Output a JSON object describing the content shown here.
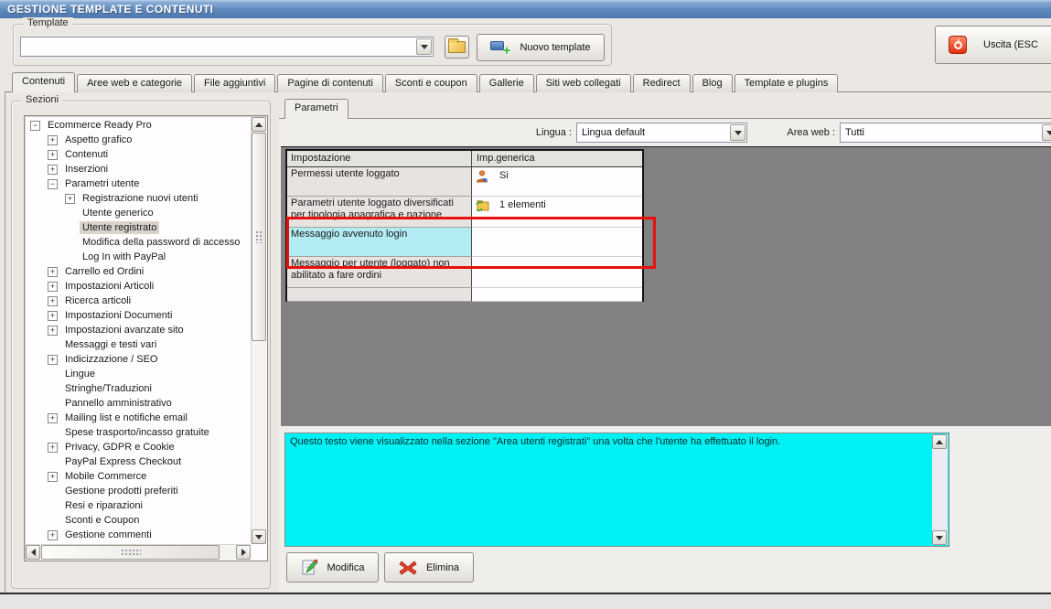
{
  "window": {
    "title": "GESTIONE TEMPLATE E CONTENUTI"
  },
  "template_bar": {
    "group_label": "Template",
    "combo_value": "",
    "new_template_label": "Nuovo template",
    "exit_label": "Uscita (ESC"
  },
  "tabs": {
    "active": "Contenuti",
    "items": [
      "Contenuti",
      "Aree web e categorie",
      "File aggiuntivi",
      "Pagine di contenuti",
      "Sconti e coupon",
      "Gallerie",
      "Siti web collegati",
      "Redirect",
      "Blog",
      "Template e plugins"
    ]
  },
  "sidebar": {
    "group_label": "Sezioni",
    "tree": [
      {
        "label": "Ecommerce Ready Pro",
        "level": 0,
        "glyph": "minus",
        "selected": false
      },
      {
        "label": "Aspetto grafico",
        "level": 1,
        "glyph": "plus",
        "selected": false
      },
      {
        "label": "Contenuti",
        "level": 1,
        "glyph": "plus",
        "selected": false
      },
      {
        "label": "Inserzioni",
        "level": 1,
        "glyph": "plus",
        "selected": false
      },
      {
        "label": "Parametri utente",
        "level": 1,
        "glyph": "minus",
        "selected": false
      },
      {
        "label": "Registrazione nuovi utenti",
        "level": 2,
        "glyph": "plus",
        "selected": false
      },
      {
        "label": "Utente generico",
        "level": 2,
        "glyph": "none",
        "selected": false
      },
      {
        "label": "Utente registrato",
        "level": 2,
        "glyph": "none",
        "selected": true
      },
      {
        "label": "Modifica della password di accesso",
        "level": 2,
        "glyph": "none",
        "selected": false
      },
      {
        "label": "Log In with PayPal",
        "level": 2,
        "glyph": "none",
        "selected": false
      },
      {
        "label": "Carrello ed Ordini",
        "level": 1,
        "glyph": "plus",
        "selected": false
      },
      {
        "label": "Impostazioni Articoli",
        "level": 1,
        "glyph": "plus",
        "selected": false
      },
      {
        "label": "Ricerca articoli",
        "level": 1,
        "glyph": "plus",
        "selected": false
      },
      {
        "label": "Impostazioni Documenti",
        "level": 1,
        "glyph": "plus",
        "selected": false
      },
      {
        "label": "Impostazioni avanzate sito",
        "level": 1,
        "glyph": "plus",
        "selected": false
      },
      {
        "label": "Messaggi e testi vari",
        "level": 1,
        "glyph": "none",
        "selected": false
      },
      {
        "label": "Indicizzazione / SEO",
        "level": 1,
        "glyph": "plus",
        "selected": false
      },
      {
        "label": "Lingue",
        "level": 1,
        "glyph": "none",
        "selected": false
      },
      {
        "label": "Stringhe/Traduzioni",
        "level": 1,
        "glyph": "none",
        "selected": false
      },
      {
        "label": "Pannello amministrativo",
        "level": 1,
        "glyph": "none",
        "selected": false
      },
      {
        "label": "Mailing list e notifiche email",
        "level": 1,
        "glyph": "plus",
        "selected": false
      },
      {
        "label": "Spese trasporto/incasso gratuite",
        "level": 1,
        "glyph": "none",
        "selected": false
      },
      {
        "label": "Privacy, GDPR e Cookie",
        "level": 1,
        "glyph": "plus",
        "selected": false
      },
      {
        "label": "PayPal Express Checkout",
        "level": 1,
        "glyph": "none",
        "selected": false
      },
      {
        "label": "Mobile Commerce",
        "level": 1,
        "glyph": "plus",
        "selected": false
      },
      {
        "label": "Gestione prodotti preferiti",
        "level": 1,
        "glyph": "none",
        "selected": false
      },
      {
        "label": "Resi e riparazioni",
        "level": 1,
        "glyph": "none",
        "selected": false
      },
      {
        "label": "Sconti e Coupon",
        "level": 1,
        "glyph": "none",
        "selected": false
      },
      {
        "label": "Gestione commenti",
        "level": 1,
        "glyph": "plus",
        "selected": false
      }
    ]
  },
  "content": {
    "tab_label": "Parametri",
    "lingua_label": "Lingua :",
    "lingua_value": "Lingua default",
    "area_label": "Area web :",
    "area_value": "Tutti",
    "table": {
      "headers": [
        "Impostazione",
        "Imp.generica"
      ],
      "rows": [
        {
          "setting": "Permessi utente loggato",
          "icon": "user-icon",
          "value": "Si",
          "selected": false
        },
        {
          "setting": "Parametri utente loggato diversificati per tipologia anagrafica e nazione",
          "icon": "folder-elements-icon",
          "value": "1 elementi",
          "selected": false
        },
        {
          "setting": "Messaggio avvenuto login",
          "icon": "",
          "value": "",
          "selected": true
        },
        {
          "setting": "Messaggio per utente (loggato) non abilitato a fare ordini",
          "icon": "",
          "value": "",
          "selected": false
        },
        {
          "setting": "",
          "icon": "",
          "value": "",
          "selected": false
        }
      ]
    },
    "description_text": "Questo testo viene visualizzato nella sezione \"Area utenti registrati\" una volta che l'utente ha effettuato il login.",
    "buttons": {
      "modifica": "Modifica",
      "elimina": "Elimina"
    }
  },
  "colors": {
    "window_bg": "#ebe8e4",
    "titlebar_top": "#87abd4",
    "titlebar_bottom": "#4d79ae",
    "dark_panel_gray": "#828082",
    "selection_cyan": "#b2ecf2",
    "textarea_cyan": "#00f2f4",
    "annotation_red": "#e8100c"
  }
}
